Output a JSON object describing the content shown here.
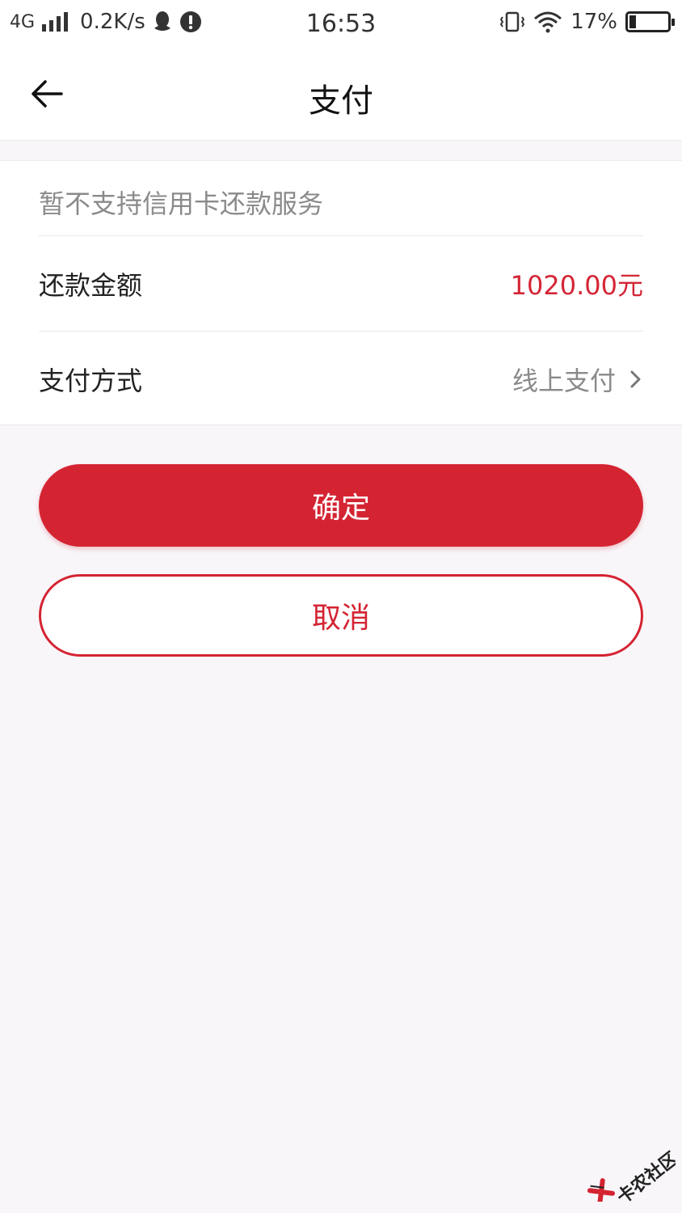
{
  "status_bar": {
    "network": "4G",
    "speed": "0.2K/s",
    "time": "16:53",
    "battery": "17%",
    "battery_level": 0.17
  },
  "nav": {
    "title": "支付"
  },
  "form": {
    "notice": "暂不支持信用卡还款服务",
    "amount_label": "还款金额",
    "amount_value": "1020.00元",
    "method_label": "支付方式",
    "method_value": "线上支付"
  },
  "buttons": {
    "confirm": "确定",
    "cancel": "取消"
  },
  "watermark": {
    "text": "卡农社区"
  },
  "colors": {
    "accent": "#d42432",
    "amount": "#d42636",
    "muted": "#8a8a8a",
    "background": "#f8f6f9"
  }
}
